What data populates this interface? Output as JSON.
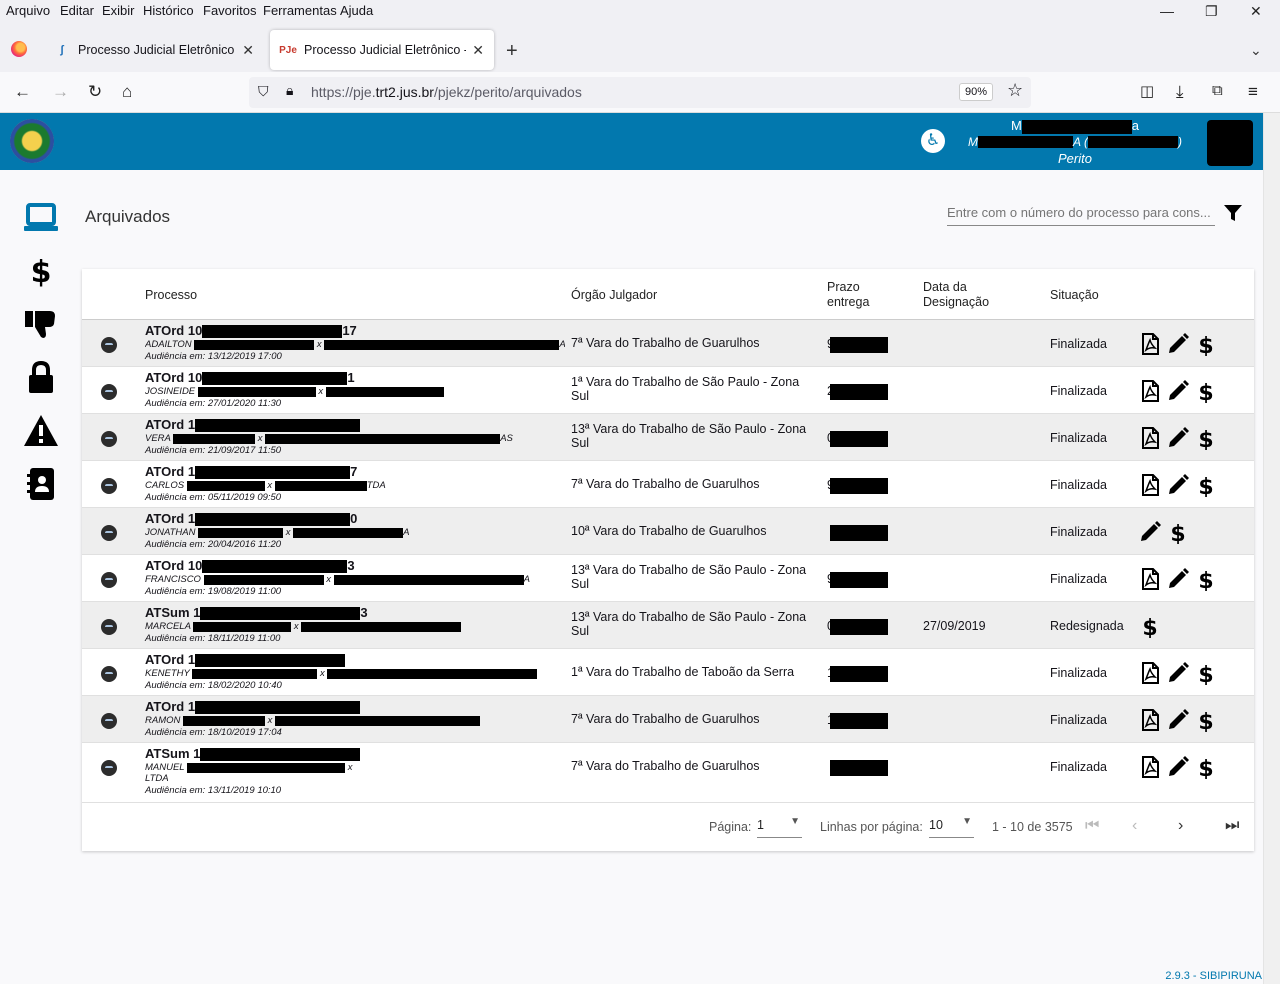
{
  "menubar": {
    "items": [
      "Arquivo",
      "Editar",
      "Exibir",
      "Histórico",
      "Favoritos",
      "Ferramentas",
      "Ajuda"
    ]
  },
  "tabs": [
    {
      "title": "Processo Judicial Eletrônico - PJe",
      "active": false
    },
    {
      "title": "Processo Judicial Eletrônico - KZ",
      "active": true
    }
  ],
  "address_bar": {
    "url_prefix": "https://pje.",
    "url_host": "trt2.jus.br",
    "url_path": "/pjekz/perito/arquivados",
    "zoom": "90%"
  },
  "header": {
    "user_name": "M",
    "user_name_tail": "a",
    "user_detail_head": "M",
    "user_detail_mid": "A (",
    "user_detail_tail": ")",
    "role": "Perito"
  },
  "sidebar": {
    "icons": [
      "laptop-icon",
      "dollar-icon",
      "thumbs-down-icon",
      "lock-icon",
      "warning-icon",
      "contact-book-icon"
    ]
  },
  "page": {
    "title": "Arquivados",
    "search_placeholder": "Entre com o número do processo para cons..."
  },
  "table": {
    "headers": {
      "processo": "Processo",
      "orgao": "Órgão Julgador",
      "prazo_1": "Prazo",
      "prazo_2": "entrega",
      "data_1": "Data da",
      "data_2": "Designação",
      "situacao": "Situação"
    },
    "rows": [
      {
        "num": "ATOrd 10",
        "num_tail": "17",
        "party1": "ADAILTON",
        "party2": "AS",
        "aud": "Audiência em: 13/12/2019 17:00",
        "orgao": "7ª Vara do Trabalho de Guarulhos",
        "prazo": "9",
        "data": "",
        "situacao": "Finalizada",
        "actions": [
          "pdf",
          "edit",
          "dollar"
        ]
      },
      {
        "num": "ATOrd 10",
        "num_tail": "1",
        "party1": "JOSINEIDE",
        "party2": "",
        "aud": "Audiência em: 27/01/2020 11:30",
        "orgao": "1ª Vara do Trabalho de São Paulo - Zona Sul",
        "prazo": "2",
        "data": "",
        "situacao": "Finalizada",
        "actions": [
          "pdf",
          "edit",
          "dollar"
        ]
      },
      {
        "num": "ATOrd 1",
        "num_tail": "",
        "party1": "VERA",
        "party2": "AS",
        "aud": "Audiência em: 21/09/2017 11:50",
        "orgao": "13ª Vara do Trabalho de São Paulo - Zona Sul",
        "prazo": "02",
        "data": "",
        "situacao": "Finalizada",
        "actions": [
          "pdf",
          "edit",
          "dollar"
        ]
      },
      {
        "num": "ATOrd 1",
        "num_tail": "7",
        "party1": "CARLOS",
        "party2": "TDA",
        "aud": "Audiência em: 05/11/2019 09:50",
        "orgao": "7ª Vara do Trabalho de Guarulhos",
        "prazo": "9",
        "data": "",
        "situacao": "Finalizada",
        "actions": [
          "pdf",
          "edit",
          "dollar"
        ]
      },
      {
        "num": "ATOrd 1",
        "num_tail": "0",
        "party1": "JONATHAN",
        "party2": "A",
        "aud": "Audiência em: 20/04/2016 11:20",
        "orgao": "10ª Vara do Trabalho de Guarulhos",
        "prazo": "",
        "data": "",
        "situacao": "Finalizada",
        "actions": [
          "edit",
          "dollar"
        ]
      },
      {
        "num": "ATOrd 10",
        "num_tail": "3",
        "party1": "FRANCISCO",
        "party2": "A",
        "aud": "Audiência em: 19/08/2019 11:00",
        "orgao": "13ª Vara do Trabalho de São Paulo - Zona Sul",
        "prazo": "9",
        "data": "",
        "situacao": "Finalizada",
        "actions": [
          "pdf",
          "edit",
          "dollar"
        ]
      },
      {
        "num": "ATSum 1",
        "num_tail": "3",
        "party1": "MARCELA",
        "party2": "",
        "aud": "Audiência em: 18/11/2019 11:00",
        "orgao": "13ª Vara do Trabalho de São Paulo - Zona Sul",
        "prazo": "0",
        "data": "27/09/2019",
        "situacao": "Redesignada",
        "actions": [
          "dollar"
        ]
      },
      {
        "num": "ATOrd 1",
        "num_tail": "",
        "party1": "KENETHY",
        "party2": "",
        "aud": "Audiência em: 18/02/2020 10:40",
        "orgao": "1ª Vara do Trabalho de Taboão da Serra",
        "prazo": "1",
        "data": "",
        "situacao": "Finalizada",
        "actions": [
          "pdf",
          "edit",
          "dollar"
        ]
      },
      {
        "num": "ATOrd 1",
        "num_tail": "",
        "party1": "RAMON",
        "party2": "",
        "aud": "Audiência em: 18/10/2019 17:04",
        "orgao": "7ª Vara do Trabalho de Guarulhos",
        "prazo": "1",
        "data": "",
        "situacao": "Finalizada",
        "actions": [
          "pdf",
          "edit",
          "dollar"
        ]
      },
      {
        "num": "ATSum 1",
        "num_tail": "",
        "party1": "MANUEL",
        "party2": "",
        "party3": "LTDA",
        "aud": "Audiência em: 13/11/2019 10:10",
        "orgao": "7ª Vara do Trabalho de Guarulhos",
        "prazo": "",
        "data": "",
        "situacao": "Finalizada",
        "actions": [
          "pdf",
          "edit",
          "dollar"
        ]
      }
    ]
  },
  "paginator": {
    "page_label": "Página:",
    "page_value": "1",
    "rows_label": "Linhas por página:",
    "rows_value": "10",
    "range": "1 - 10 de 3575"
  },
  "footer": {
    "version": "2.9.3 - SIBIPIRUNA"
  }
}
